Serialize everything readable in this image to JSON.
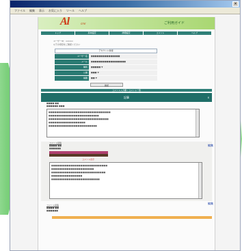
{
  "menu": {
    "items": [
      "ファイル",
      "編集",
      "表示",
      "お気に入り",
      "ツール",
      "ヘルプ"
    ]
  },
  "site": {
    "logo": "Al",
    "logo_sub": "cmr",
    "tagline": "",
    "banner_right": "ご利用ガイド"
  },
  "nav": {
    "items": [
      "トップ",
      "基本設定",
      "詳細設定",
      "コメント",
      "ヘルプ"
    ]
  },
  "info_lines": [
    "ユーザーID：xxxxxx",
    "以下の項目をご確認ください"
  ],
  "form": {
    "title": "アカウント情報",
    "rows": [
      {
        "label": "ユーザー名",
        "value": "■■■■■■■■■■■■■■■"
      },
      {
        "label": "メール",
        "value": "■■■■■■■■■■■■■■■■■■"
      },
      {
        "label": "種別",
        "value": "■■■■■ ▼"
      },
      {
        "label": "公開",
        "value": "■■■ ▼"
      },
      {
        "label": "掲載",
        "value": "■■ ▼"
      }
    ],
    "submit_label": "確認"
  },
  "section_bar_label": "コメント入力欄 / コメント一覧",
  "section_title": "記事",
  "section_close": "x",
  "first_entry": {
    "meta": [
      "■■■■ ■■",
      "■■■■■■ ■■■"
    ],
    "body_lines": [
      "■■■■■■■■■■■■■■■■■■■■■■■■■■■■■■■■",
      "■■■■■■■■■■■■■■■■■■■■■■■■■■",
      "■■■■■■■■■■■■■■■■■■■■■■■■■■■■■■■",
      "■■■■■■■■■■■■■■■■■■■",
      "■■■■■■■■■■■■■■■■■■■■■■■■■"
    ],
    "side_link": "編集"
  },
  "second_entry": {
    "title": "コメント投稿",
    "meta": [
      "■■■■ ■■",
      "■■■■■■"
    ],
    "caption": "コメント表示",
    "body_lines": [
      "■■■■■■■■■■■■■■■■■■■■■■■■■■■■■",
      "■■■■■■■■■■■■■■■■■■■■■■",
      "■■■■■■■■■■■■■■■■■■■■■■■■■■■■",
      "■■■■■■■■■■■■■■■■",
      "■■■■■■■■■■■■■■■■■■■■■■■■■"
    ],
    "side_link": "編集"
  },
  "third_entry": {
    "title": "コメント投稿",
    "meta": [
      "■■■■ ■■",
      "■■■■■■"
    ]
  },
  "colors": {
    "teal": "#2f7f78",
    "banner": "#a9d772",
    "arrow": "#48b848",
    "logo": "#d03a18"
  }
}
